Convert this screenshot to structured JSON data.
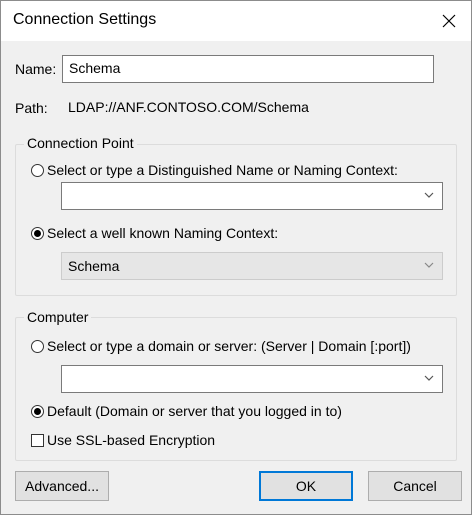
{
  "window": {
    "title": "Connection Settings"
  },
  "name_field": {
    "label": "Name:",
    "value": "Schema"
  },
  "path_field": {
    "label": "Path:",
    "value": "LDAP://ANF.CONTOSO.COM/Schema"
  },
  "connection_point": {
    "title": "Connection Point",
    "option_dn_label": "Select or type a Distinguished Name or Naming Context:",
    "dn_value": "",
    "option_known_label": "Select a well known Naming Context:",
    "known_value": "Schema",
    "selected": "known"
  },
  "computer": {
    "title": "Computer",
    "option_server_label": "Select or type a domain or server: (Server | Domain [:port])",
    "server_value": "",
    "option_default_label": "Default (Domain or server that you logged in to)",
    "selected": "default",
    "ssl_label": "Use SSL-based Encryption",
    "ssl_checked": false
  },
  "buttons": {
    "advanced": "Advanced...",
    "ok": "OK",
    "cancel": "Cancel"
  },
  "colors": {
    "accent": "#0078d7",
    "dialog_bg": "#f0f0f0"
  }
}
